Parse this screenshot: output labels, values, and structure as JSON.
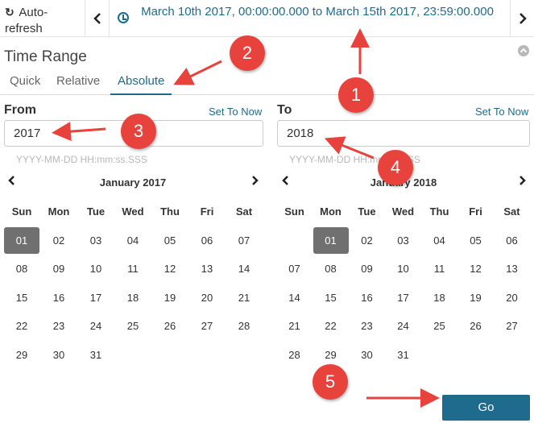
{
  "topbar": {
    "autorefresh_label": "Auto-refresh",
    "range_text": "March 10th 2017, 00:00:00.000 to March 15th 2017, 23:59:00.000"
  },
  "header": {
    "title": "Time Range",
    "tabs": [
      "Quick",
      "Relative",
      "Absolute"
    ],
    "active_tab": "Absolute"
  },
  "from": {
    "label": "From",
    "set_to_now": "Set To Now",
    "value": "2017",
    "hint": "YYYY-MM-DD HH:mm:ss.SSS",
    "calendar": {
      "title": "January 2017",
      "weekdays": [
        "Sun",
        "Mon",
        "Tue",
        "Wed",
        "Thu",
        "Fri",
        "Sat"
      ],
      "weeks": [
        [
          "01",
          "02",
          "03",
          "04",
          "05",
          "06",
          "07"
        ],
        [
          "08",
          "09",
          "10",
          "11",
          "12",
          "13",
          "14"
        ],
        [
          "15",
          "16",
          "17",
          "18",
          "19",
          "20",
          "21"
        ],
        [
          "22",
          "23",
          "24",
          "25",
          "26",
          "27",
          "28"
        ],
        [
          "29",
          "30",
          "31",
          "",
          "",
          "",
          ""
        ]
      ],
      "selected": "01"
    }
  },
  "to": {
    "label": "To",
    "set_to_now": "Set To Now",
    "value": "2018",
    "hint": "YYYY-MM-DD HH:mm:ss.SSS",
    "calendar": {
      "title": "January 2018",
      "weekdays": [
        "Sun",
        "Mon",
        "Tue",
        "Wed",
        "Thu",
        "Fri",
        "Sat"
      ],
      "weeks": [
        [
          "",
          "01",
          "02",
          "03",
          "04",
          "05",
          "06"
        ],
        [
          "07",
          "08",
          "09",
          "10",
          "11",
          "12",
          "13"
        ],
        [
          "14",
          "15",
          "16",
          "17",
          "18",
          "19",
          "20"
        ],
        [
          "21",
          "22",
          "23",
          "24",
          "25",
          "26",
          "27"
        ],
        [
          "28",
          "29",
          "30",
          "31",
          "",
          "",
          ""
        ]
      ],
      "selected": "01"
    }
  },
  "go_label": "Go",
  "annotations": [
    "1",
    "2",
    "3",
    "4",
    "5"
  ],
  "colors": {
    "accent": "#1f6b8e",
    "annotation": "#e8423d",
    "selected_day": "#707070"
  }
}
